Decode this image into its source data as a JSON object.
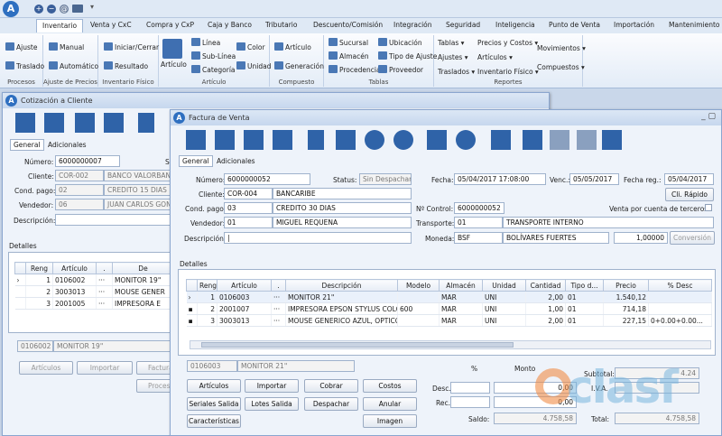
{
  "ribbon": {
    "tabs": [
      "Inventario",
      "Venta y CxC",
      "Compra y CxP",
      "Caja y Banco",
      "Tributario",
      "Descuento/Comisión",
      "Integración",
      "Seguridad",
      "Inteligencia",
      "Punto de Venta",
      "Importación",
      "Mantenimiento"
    ],
    "groups": {
      "procesos": {
        "caption": "Procesos",
        "items": [
          "Ajuste",
          "Traslado"
        ]
      },
      "ajuste_precios": {
        "caption": "Ajuste de Precios",
        "items": [
          "Manual",
          "Automático"
        ]
      },
      "inv_fisico": {
        "caption": "Inventario Físico",
        "items": [
          "Iniciar/Cerrar",
          "Resultado"
        ]
      },
      "articulo": {
        "caption": "Artículo",
        "big": "Artículo",
        "items": [
          "Línea",
          "Sub-Línea",
          "Categoría",
          "Color",
          "Unidad"
        ]
      },
      "compuesto": {
        "caption": "Compuesto",
        "items": [
          "Artículo",
          "Generación"
        ]
      },
      "tablas": {
        "caption": "Tablas",
        "items": [
          "Sucursal",
          "Almacén",
          "Procedencia",
          "Ubicación",
          "Tipo de Ajuste",
          "Proveedor"
        ]
      },
      "reportes": {
        "caption": "Reportes",
        "items": [
          "Tablas ▾",
          "Ajustes ▾",
          "Traslados ▾",
          "Precios y Costos ▾",
          "Artículos ▾",
          "Inventario Físico ▾",
          "Movimientos ▾",
          "Compuestos ▾"
        ]
      }
    }
  },
  "cotizacion": {
    "title": "Cotización a Cliente",
    "tabs": [
      "General",
      "Adicionales"
    ],
    "numero_label": "Número:",
    "numero": "6000000007",
    "st_label": "St",
    "cliente_label": "Cliente:",
    "cliente_code": "COR-002",
    "cliente_name": "BANCO VALORBAN",
    "cond_label": "Cond. pago:",
    "cond_code": "02",
    "cond_name": "CREDITO 15 DIAS",
    "vend_label": "Vendedor:",
    "vend_code": "06",
    "vend_name": "JUAN CARLOS GONZA",
    "desc_label": "Descripción:",
    "detalles": "Detalles",
    "cols": [
      "Reng",
      "Artículo",
      ".",
      "De"
    ],
    "rows": [
      {
        "reng": "1",
        "art": "0106002",
        "dots": "···",
        "desc": "MONITOR 19\""
      },
      {
        "reng": "2",
        "art": "3003013",
        "dots": "···",
        "desc": "MOUSE GENER"
      },
      {
        "reng": "3",
        "art": "2001005",
        "dots": "···",
        "desc": "IMPRESORA E"
      }
    ],
    "sel_code": "0106002",
    "sel_name": "MONITOR 19\"",
    "btn_articulos": "Artículos",
    "btn_importar": "Importar",
    "btn_factura": "Factura",
    "btn_procesar": "Procesa"
  },
  "factura": {
    "title": "Factura de Venta",
    "tabs": [
      "General",
      "Adicionales"
    ],
    "numero_label": "Número:",
    "numero": "6000000052",
    "status_label": "Status:",
    "status": "Sin Despachar",
    "fecha_label": "Fecha:",
    "fecha": "05/04/2017 17:08:00",
    "venc_label": "Venc.:",
    "venc": "05/05/2017",
    "fechareg_label": "Fecha reg.:",
    "fechareg": "05/04/2017",
    "cli_rapido": "Cli. Rápido",
    "cliente_label": "Cliente:",
    "cliente_code": "COR-004",
    "cliente_name": "BANCARIBE",
    "cond_label": "Cond. pago:",
    "cond_code": "03",
    "cond_name": "CREDITO 30 DIAS",
    "ncontrol_label": "Nº Control:",
    "ncontrol": "6000000052",
    "venta_terceros": "Venta por cuenta de terceros",
    "vend_label": "Vendedor:",
    "vend_code": "01",
    "vend_name": "MIGUEL REQUENA",
    "transp_label": "Transporte:",
    "transp_code": "01",
    "transp_name": "TRANSPORTE INTERNO",
    "desc_label": "Descripción:",
    "moneda_label": "Moneda:",
    "moneda_code": "BSF",
    "moneda_name": "BOLÍVARES FUERTES",
    "tasa": "1,00000",
    "conversion": "Conversión",
    "detalles": "Detalles",
    "cols": [
      "Reng",
      "Artículo",
      ".",
      "Descripción",
      "Modelo",
      "Almacén",
      "Unidad",
      "Cantidad",
      "Tipo d...",
      "Precio",
      "% Desc"
    ],
    "rows": [
      {
        "reng": "1",
        "art": "0106003",
        "dots": "···",
        "desc": "MONITOR 21\"",
        "modelo": "",
        "alm": "MAR",
        "uni": "UNI",
        "cant": "2,00",
        "tipo": "01",
        "precio": "1.540,12",
        "pdesc": ""
      },
      {
        "reng": "2",
        "art": "2001007",
        "dots": "···",
        "desc": "IMPRESORA EPSON STYLUS COLO...",
        "modelo": "600",
        "alm": "MAR",
        "uni": "UNI",
        "cant": "1,00",
        "tipo": "01",
        "precio": "714,18",
        "pdesc": ""
      },
      {
        "reng": "3",
        "art": "3003013",
        "dots": "···",
        "desc": "MOUSE GENERICO AZUL, OPTICO...",
        "modelo": "",
        "alm": "MAR",
        "uni": "UNI",
        "cant": "2,00",
        "tipo": "01",
        "precio": "227,15",
        "pdesc": "0+0.00+0.00..."
      }
    ],
    "sel_code": "0106003",
    "sel_name": "MONITOR 21\"",
    "buttons": {
      "articulos": "Artículos",
      "importar": "Importar",
      "cobrar": "Cobrar",
      "costos": "Costos",
      "seriales": "Seriales Salida",
      "lotes": "Lotes Salida",
      "despachar": "Despachar",
      "anular": "Anular",
      "caracteristicas": "Características",
      "imagen": "Imagen"
    },
    "pct_label": "%",
    "monto_label": "Monto",
    "desc_label2": "Desc.:",
    "desc_monto": "0,00",
    "rec_label": "Rec.:",
    "rec_monto": "0,00",
    "saldo_label": "Saldo:",
    "saldo": "4.758,58",
    "subtotal_label": "Subtotal:",
    "subtotal": "4.24",
    "iva_label": "I.V.A.",
    "iva": "",
    "total_label": "Total:",
    "total": "4.758,58"
  },
  "watermark": "clasf"
}
